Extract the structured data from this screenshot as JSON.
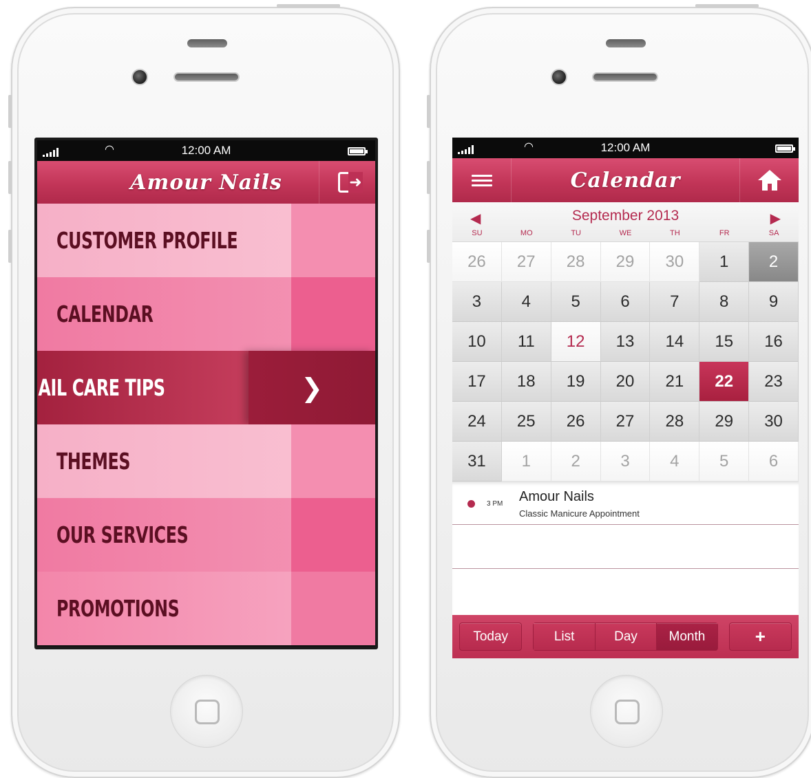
{
  "left_phone": {
    "status_bar": {
      "time": "12:00 AM"
    },
    "header": {
      "title": "Amour Nails",
      "exit_icon": "exit-icon"
    },
    "menu": [
      {
        "label": "CUSTOMER PROFILE"
      },
      {
        "label": "CALENDAR"
      },
      {
        "label": "NAIL CARE TIPS",
        "selected": true,
        "icon": "chevron-right-icon"
      },
      {
        "label": "THEMES"
      },
      {
        "label": "OUR SERVICES"
      },
      {
        "label": "PROMOTIONS"
      }
    ]
  },
  "right_phone": {
    "status_bar": {
      "time": "12:00 AM"
    },
    "header": {
      "title": "Calendar",
      "left_icon": "hamburger-menu-icon",
      "right_icon": "home-icon"
    },
    "calendar": {
      "month_label": "September 2013",
      "prev_icon": "◀",
      "next_icon": "▶",
      "weekdays": [
        "SU",
        "MO",
        "TU",
        "WE",
        "TH",
        "FR",
        "SA"
      ],
      "days": [
        {
          "n": "26",
          "muted": true
        },
        {
          "n": "27",
          "muted": true
        },
        {
          "n": "28",
          "muted": true
        },
        {
          "n": "29",
          "muted": true
        },
        {
          "n": "30",
          "muted": true
        },
        {
          "n": "1"
        },
        {
          "n": "2",
          "grey": true
        },
        {
          "n": "3"
        },
        {
          "n": "4"
        },
        {
          "n": "5"
        },
        {
          "n": "6"
        },
        {
          "n": "7"
        },
        {
          "n": "8"
        },
        {
          "n": "9"
        },
        {
          "n": "10"
        },
        {
          "n": "11"
        },
        {
          "n": "12",
          "today": true
        },
        {
          "n": "13"
        },
        {
          "n": "14"
        },
        {
          "n": "15"
        },
        {
          "n": "16"
        },
        {
          "n": "17"
        },
        {
          "n": "18"
        },
        {
          "n": "19"
        },
        {
          "n": "20"
        },
        {
          "n": "21"
        },
        {
          "n": "22",
          "selected": true
        },
        {
          "n": "23"
        },
        {
          "n": "24"
        },
        {
          "n": "25"
        },
        {
          "n": "26"
        },
        {
          "n": "27"
        },
        {
          "n": "28"
        },
        {
          "n": "29"
        },
        {
          "n": "30"
        },
        {
          "n": "31"
        },
        {
          "n": "1",
          "muted": true
        },
        {
          "n": "2",
          "muted": true
        },
        {
          "n": "3",
          "muted": true
        },
        {
          "n": "4",
          "muted": true
        },
        {
          "n": "5",
          "muted": true
        },
        {
          "n": "6",
          "muted": true
        }
      ]
    },
    "events": [
      {
        "time": "3 PM",
        "title": "Amour Nails",
        "subtitle": "Classic Manicure Appointment"
      }
    ],
    "toolbar": {
      "today": "Today",
      "list": "List",
      "day": "Day",
      "month": "Month",
      "add": "+",
      "active_view": "Month"
    }
  },
  "colors": {
    "accent": "#c23558",
    "accent_dark": "#9b1d3a",
    "pink_light": "#f9bfd1",
    "pink_mid": "#f07aa2",
    "text_dark": "#5b0f22"
  }
}
